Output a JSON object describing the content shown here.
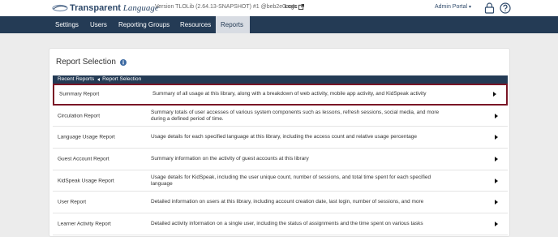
{
  "header": {
    "logo_bold": "Transparent",
    "logo_italic": "Language",
    "version": "Version TLOLib (2.64.13-SNAPSHOT) #1 @beb2e0ec4c",
    "logs_label": "Logs",
    "admin_menu_label": "Admin Portal"
  },
  "nav": {
    "items": [
      {
        "label": "Settings"
      },
      {
        "label": "Users"
      },
      {
        "label": "Reporting Groups"
      },
      {
        "label": "Resources"
      },
      {
        "label": "Reports"
      }
    ],
    "active_index": 4
  },
  "page": {
    "title": "Report Selection",
    "breadcrumb": {
      "first": "Recent Reports",
      "second": "Report Selection"
    }
  },
  "reports": [
    {
      "name": "Summary Report",
      "description": "Summary of all usage at this library, along with a breakdown of web activity, mobile app activity, and KidSpeak activity"
    },
    {
      "name": "Circulation Report",
      "description": "Summary totals of user accesses of various system components such as lessons, refresh sessions, social media, and more during a defined period of time."
    },
    {
      "name": "Language Usage Report",
      "description": "Usage details for each specified language at this library, including the access count and relative usage percentage"
    },
    {
      "name": "Guest Account Report",
      "description": "Summary information on the activity of guest accounts at this library"
    },
    {
      "name": "KidSpeak Usage Report",
      "description": "Usage details for KidSpeak, including the user unique count, number of sessions, and total time spent for each specified language"
    },
    {
      "name": "User Report",
      "description": "Detailed information on users at this library, including account creation date, last login, number of sessions, and more"
    },
    {
      "name": "Learner Activity Report",
      "description": "Detailed activity information on a single user, including the status of assignments and the time spent on various tasks"
    }
  ],
  "selected_report_index": 0,
  "colors": {
    "nav_bg": "#243b55",
    "selected_border": "#7a1626",
    "active_tab_bg": "#d8dce3"
  }
}
